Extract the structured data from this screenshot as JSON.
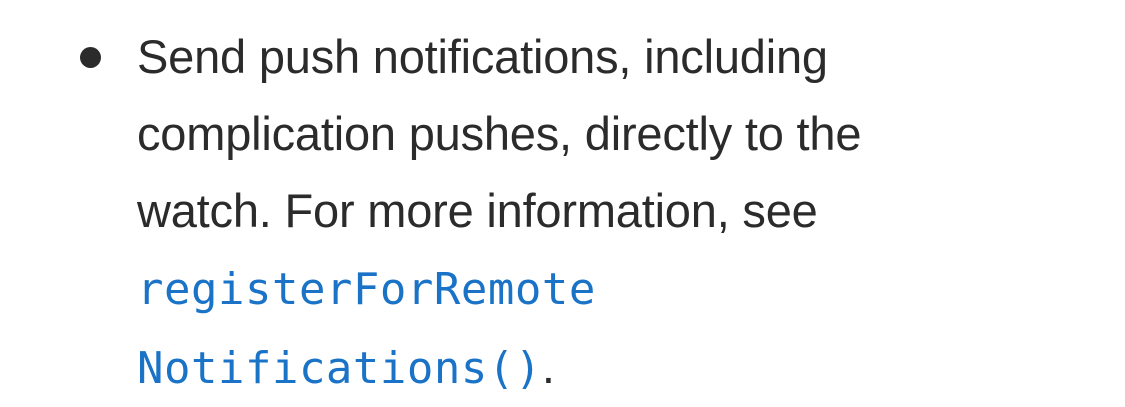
{
  "content": {
    "bullet_item": {
      "lines": [
        "Send push notifications, including",
        "complication pushes, directly to the",
        "watch. For more information, see"
      ],
      "link_line_1": "registerForRemote",
      "link_line_2": "Notifications()",
      "trailing": "."
    }
  },
  "colors": {
    "text": "#2b2b2b",
    "link": "#1a73c7",
    "background": "#ffffff"
  }
}
